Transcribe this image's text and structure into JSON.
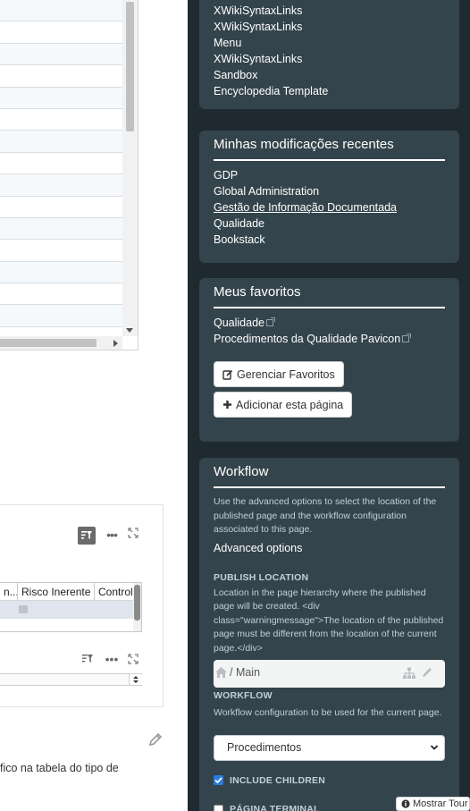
{
  "top_links": [
    "XWikiSyntaxLinks",
    "XWikiSyntaxLinks",
    "Menu",
    "XWikiSyntaxLinks",
    "Sandbox",
    "Encyclopedia Template"
  ],
  "recent_changes": {
    "title": "Minhas modificações recentes",
    "items": [
      "GDP",
      "Global Administration",
      "Gestão de Informação Documentada",
      "Qualidade",
      "Bookstack"
    ]
  },
  "favorites": {
    "title": "Meus favoritos",
    "items": [
      "Qualidade",
      "Procedimentos da Qualidade Pavicon"
    ],
    "manage_label": "Gerenciar Favoritos",
    "add_label": "Adicionar esta página"
  },
  "workflow": {
    "title": "Workflow",
    "description": "Use the advanced options to select the location of the published page and the workflow configuration associated to this page.",
    "advanced_options": "Advanced options",
    "publish_location_label": "PUBLISH LOCATION",
    "publish_location_help": "Location in the page hierarchy where the published page will be created. <div class=\"warningmessage\">The location of the published page must be different from the location of the current page.</div>",
    "location_value": "/ Main",
    "workflow_label": "WORKFLOW",
    "workflow_help": "Workflow configuration to be used for the current page.",
    "workflow_selected": "Procedimentos",
    "include_children": "INCLUDE CHILDREN",
    "include_children_checked": true,
    "pagina_terminal": "PÁGINA TERMINAL",
    "pagina_terminal_checked": false
  },
  "table2": {
    "columns": [
      "n...",
      "Risco Inerente",
      "Controle"
    ]
  },
  "body_text": "fico na tabela do tipo de",
  "tour_button": "Mostrar Tour",
  "colors": {
    "sidebar_bg": "#1f2a30",
    "card_bg": "#34444c",
    "checkbox_accent": "#2b7be4"
  }
}
